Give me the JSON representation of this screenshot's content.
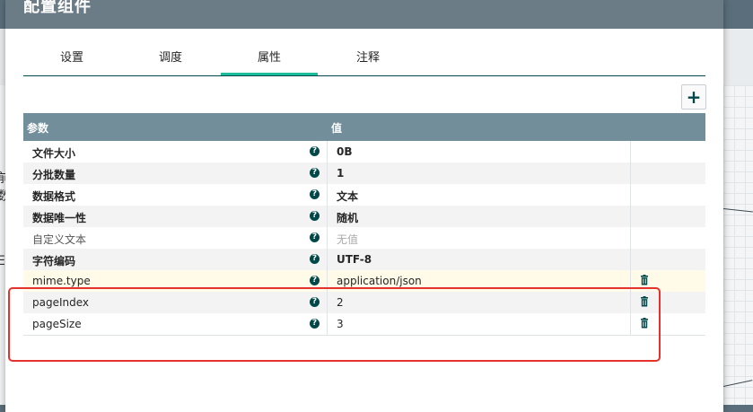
{
  "dialog": {
    "title": "配置组件"
  },
  "tabs": [
    {
      "label": "设置"
    },
    {
      "label": "调度"
    },
    {
      "label": "属性"
    },
    {
      "label": "注释"
    }
  ],
  "active_tab": "属性",
  "grid": {
    "header_param": "参数",
    "header_value": "值"
  },
  "rows": [
    {
      "name": "文件大小",
      "value": "0B"
    },
    {
      "name": "分批数量",
      "value": "1"
    },
    {
      "name": "数据格式",
      "value": "文本"
    },
    {
      "name": "数据唯一性",
      "value": "随机"
    },
    {
      "name": "自定义文本",
      "value": "无值"
    },
    {
      "name": "字符编码",
      "value": "UTF-8"
    },
    {
      "name": "mime.type",
      "value": "application/json"
    },
    {
      "name": "pageIndex",
      "value": "2"
    },
    {
      "name": "pageSize",
      "value": "3"
    }
  ],
  "background_fragments": [
    "前",
    "数",
    "E"
  ],
  "colors": {
    "header_bar": "#6b7c86",
    "grid_header": "#728e9b",
    "active_tab_underline": "#1abc9c",
    "icon_dark": "#004849",
    "annotation_red": "#e5322d",
    "highlight_row": "#fffbe8"
  }
}
